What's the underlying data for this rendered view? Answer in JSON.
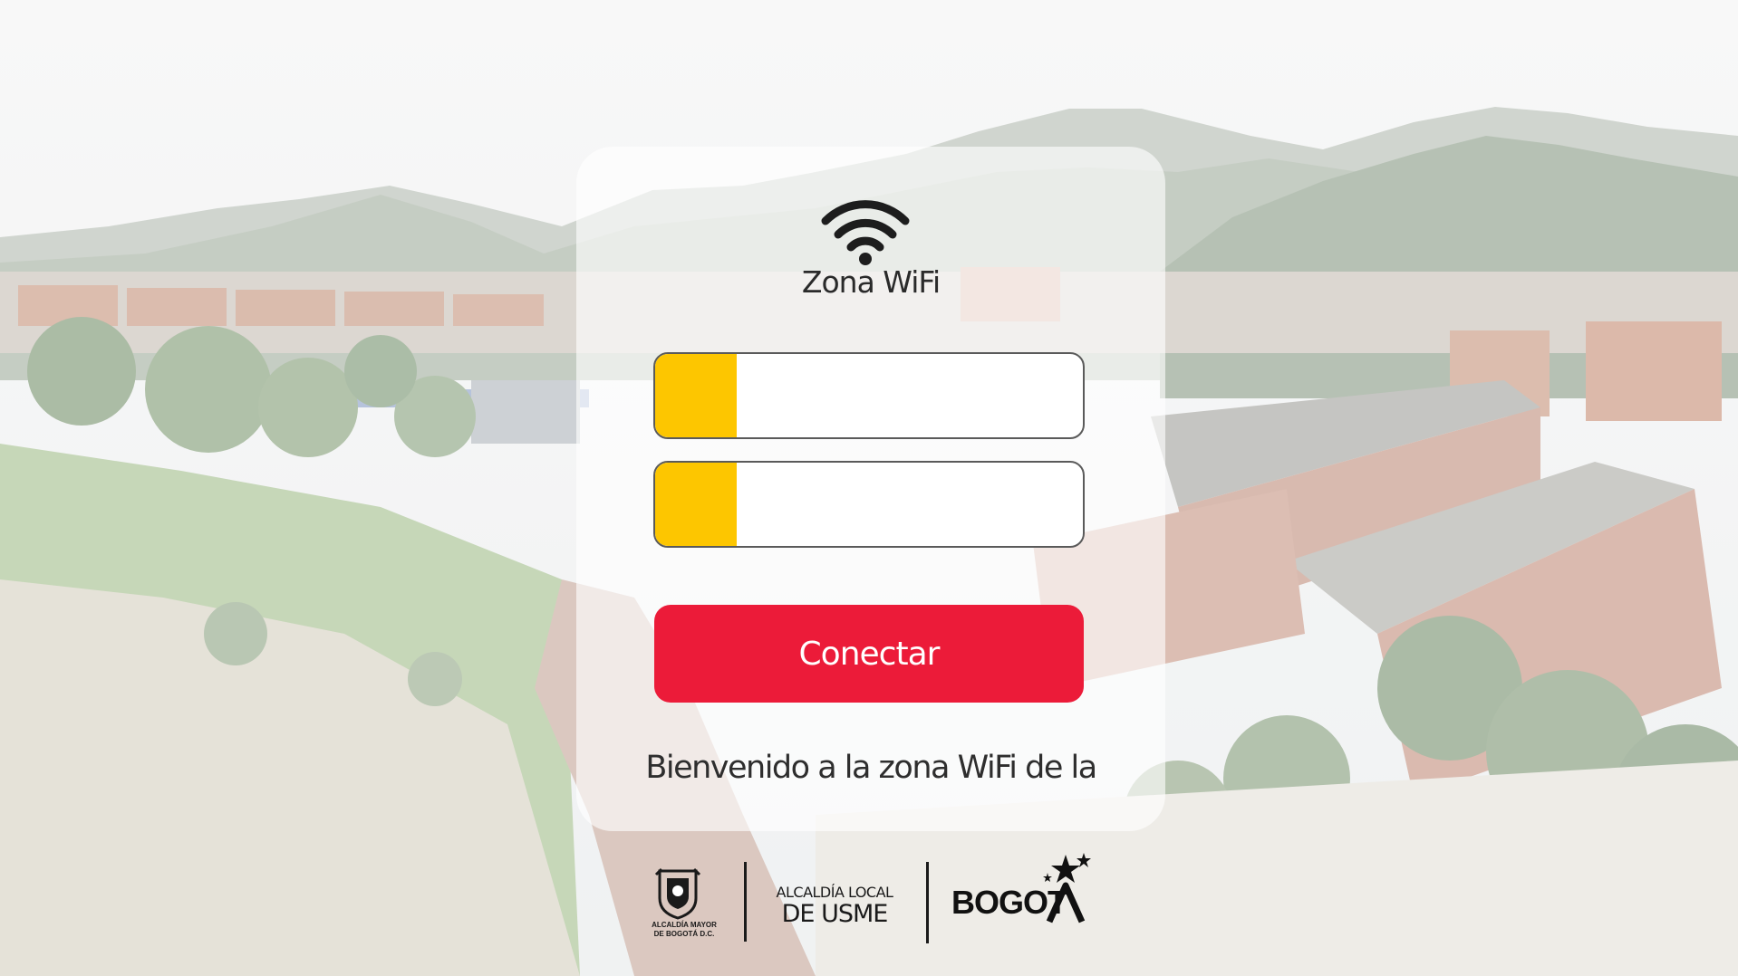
{
  "background": {
    "icon": "usme-neighborhood-photo"
  },
  "card": {
    "icon": "wifi-icon",
    "title": "Zona WiFi",
    "fields": [
      {
        "placeholder": ""
      },
      {
        "placeholder": ""
      }
    ],
    "connect_label": "Conectar",
    "welcome_text": "Bienvenido a la zona WiFi de la"
  },
  "footer": {
    "crest_line1": "ALCALDÍA MAYOR",
    "crest_line2": "DE BOGOTÁ D.C.",
    "usme_line1": "ALCALDÍA LOCAL",
    "usme_line2": "DE USME",
    "bogota_label": "BOGOT"
  },
  "colors": {
    "accent_yellow": "#fdc600",
    "button_red": "#ec1b39",
    "text_dark": "#2a2a2a"
  }
}
